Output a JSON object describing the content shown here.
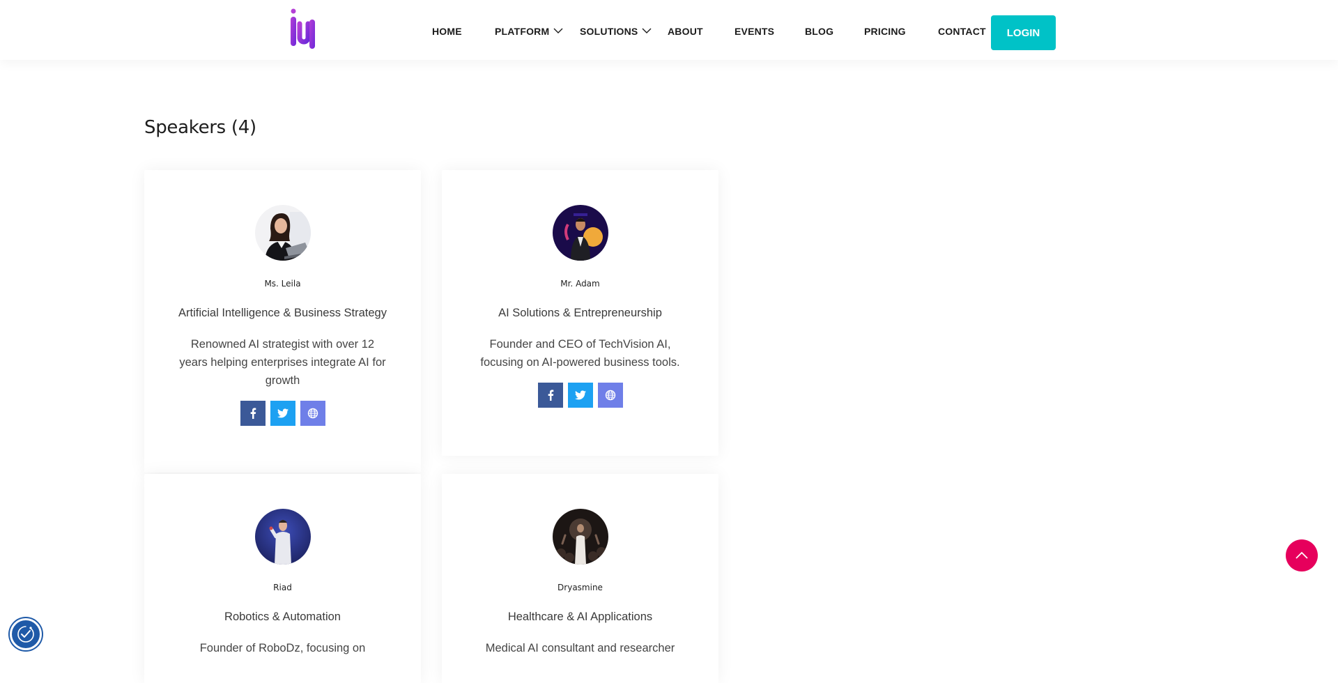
{
  "nav": {
    "items": [
      {
        "label": "HOME"
      },
      {
        "label": "PLATFORM"
      },
      {
        "label": "SOLUTIONS"
      },
      {
        "label": "ABOUT"
      },
      {
        "label": "EVENTS"
      },
      {
        "label": "BLOG"
      },
      {
        "label": "PRICING"
      },
      {
        "label": "CONTACT"
      }
    ],
    "login_label": "LOGIN"
  },
  "speakers": {
    "title": "Speakers (4)",
    "cards": [
      {
        "name": "Ms. Leila",
        "topic": "Artificial Intelligence & Business Strategy",
        "bio": "Renowned AI strategist with over 12 years helping enterprises integrate AI for growth",
        "avatar_icon": "speaker-photo-woman-laptop"
      },
      {
        "name": "Mr. Adam",
        "topic": "AI Solutions & Entrepreneurship",
        "bio": "Founder and CEO of TechVision AI, focusing on AI-powered business tools.",
        "avatar_icon": "speaker-photo-man-stage"
      },
      {
        "name": "Riad",
        "topic": "Robotics & Automation",
        "bio": "Founder of RoboDz, focusing on",
        "avatar_icon": "speaker-photo-presenter"
      },
      {
        "name": "Dryasmine",
        "topic": "Healthcare & AI Applications",
        "bio": "Medical AI consultant and researcher",
        "avatar_icon": "speaker-photo-audience"
      }
    ]
  },
  "colors": {
    "accent": "#00c2c7",
    "scroll_top": "#e6005c",
    "facebook": "#3b5998",
    "twitter": "#1da1f2",
    "website": "#6f7fe8",
    "logo_purple": "#8a2be2"
  }
}
